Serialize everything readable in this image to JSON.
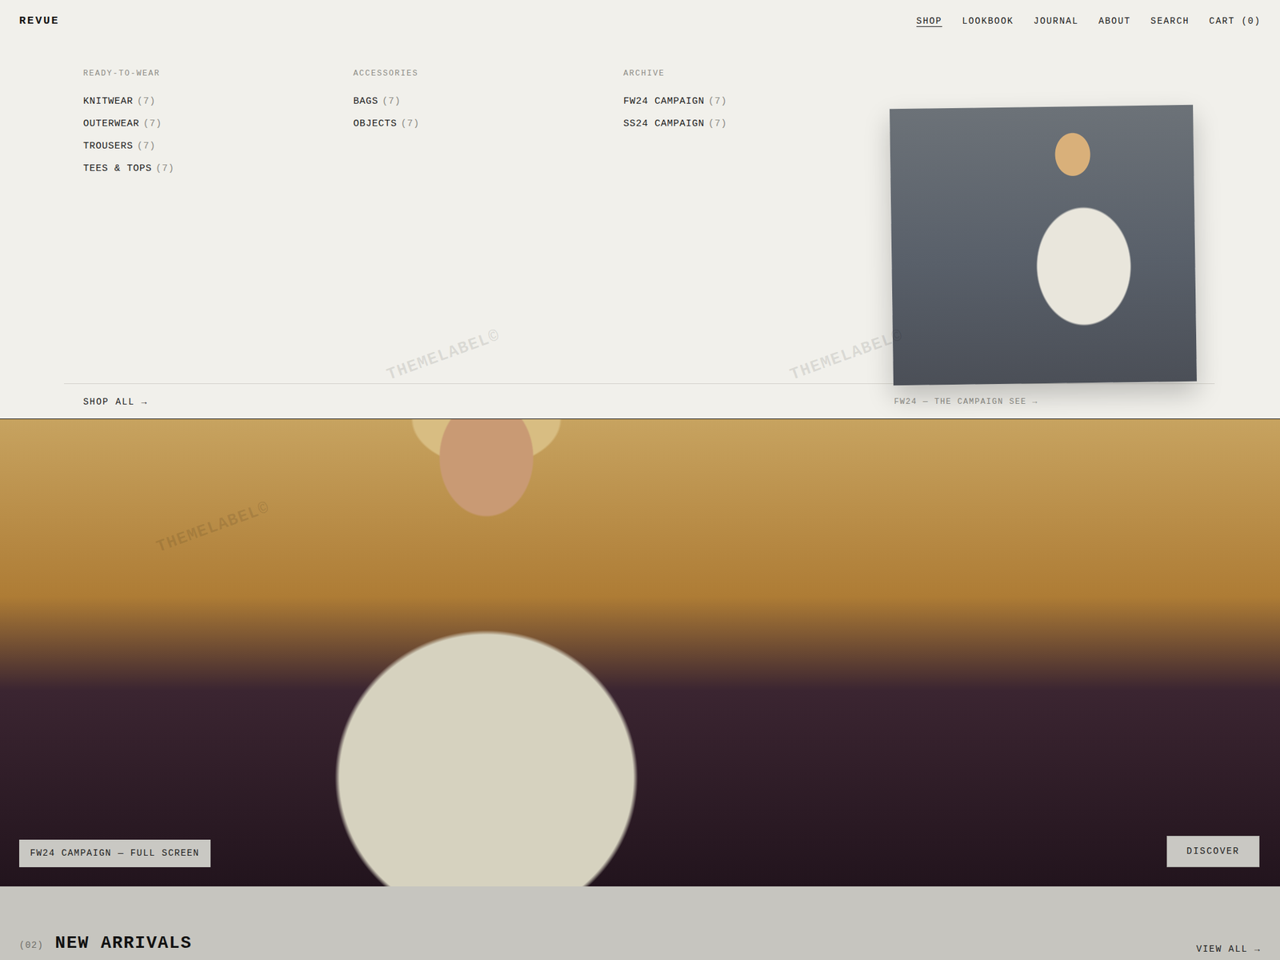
{
  "brand": {
    "logo": "REVUE"
  },
  "nav": [
    {
      "label": "SHOP",
      "selected": true
    },
    {
      "label": "LOOKBOOK",
      "selected": false
    },
    {
      "label": "JOURNAL",
      "selected": false
    },
    {
      "label": "ABOUT",
      "selected": false
    },
    {
      "label": "SEARCH",
      "selected": false
    },
    {
      "label": "CART (0)",
      "selected": false
    }
  ],
  "menu": {
    "columns": [
      {
        "heading": "READY-TO-WEAR",
        "items": [
          {
            "label": "KNITWEAR",
            "count": "(7)"
          },
          {
            "label": "OUTERWEAR",
            "count": "(7)"
          },
          {
            "label": "TROUSERS",
            "count": "(7)"
          },
          {
            "label": "TEES & TOPS",
            "count": "(7)"
          }
        ]
      },
      {
        "heading": "ACCESSORIES",
        "items": [
          {
            "label": "BAGS",
            "count": "(7)"
          },
          {
            "label": "OBJECTS",
            "count": "(7)"
          }
        ]
      },
      {
        "heading": "ARCHIVE",
        "items": [
          {
            "label": "FW24 CAMPAIGN",
            "count": "(7)"
          },
          {
            "label": "SS24 CAMPAIGN",
            "count": "(7)"
          }
        ]
      }
    ],
    "feature": {
      "caption": "FW24 — THE CAMPAIGN SEE →"
    },
    "shop_all": "SHOP ALL →"
  },
  "hero": {
    "label": "FW24 CAMPAIGN — FULL SCREEN",
    "button": "DISCOVER"
  },
  "section": {
    "index": "(02)",
    "title": "NEW ARRIVALS",
    "link": "VIEW ALL →"
  },
  "watermark": "THEMELABEL©"
}
